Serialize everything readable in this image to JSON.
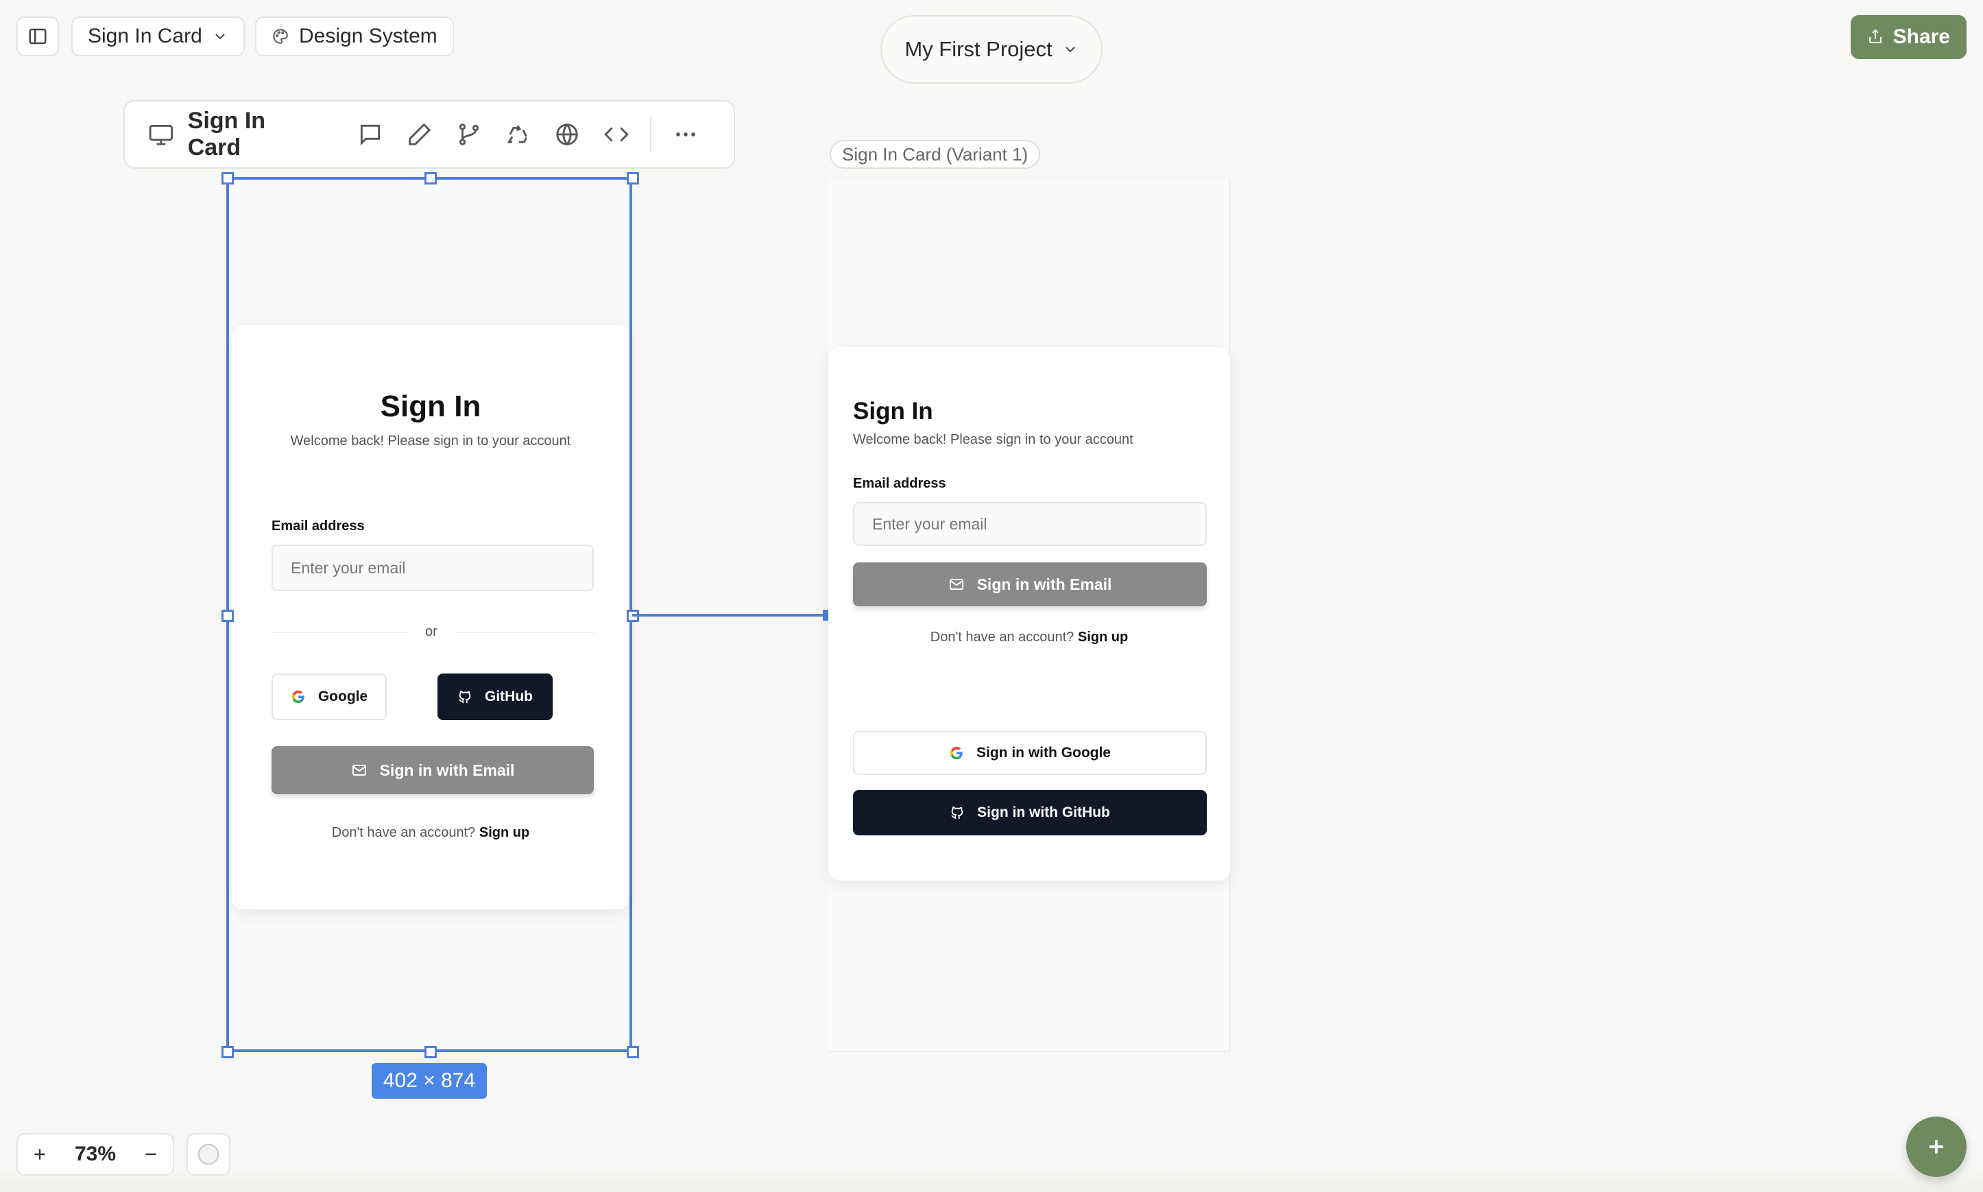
{
  "topbar": {
    "page_select": "Sign In Card",
    "design_system": "Design System",
    "project": "My First Project",
    "share": "Share"
  },
  "frame_toolbar": {
    "title": "Sign In Card"
  },
  "frame1": {
    "size_badge": "402 × 874",
    "card": {
      "title": "Sign In",
      "subtitle": "Welcome back! Please sign in to your account",
      "email_label": "Email address",
      "email_placeholder": "Enter your email",
      "divider": "or",
      "google": "Google",
      "github": "GitHub",
      "email_button": "Sign in with Email",
      "signup_prompt": "Don't have an account?",
      "signup_link": "Sign up"
    }
  },
  "frame2": {
    "label": "Sign In Card (Variant 1)",
    "card": {
      "title": "Sign In",
      "subtitle": "Welcome back! Please sign in to your account",
      "email_label": "Email address",
      "email_placeholder": "Enter your email",
      "email_button": "Sign in with Email",
      "signup_prompt": "Don't have an account?",
      "signup_link": "Sign up",
      "google_button": "Sign in with Google",
      "github_button": "Sign in with GitHub"
    }
  },
  "zoom": {
    "value": "73%"
  },
  "colors": {
    "accent_green": "#6e8a5f",
    "selection_blue": "#4f7ed9",
    "dark_button": "#111827",
    "gray_button": "#8a8a8a"
  }
}
